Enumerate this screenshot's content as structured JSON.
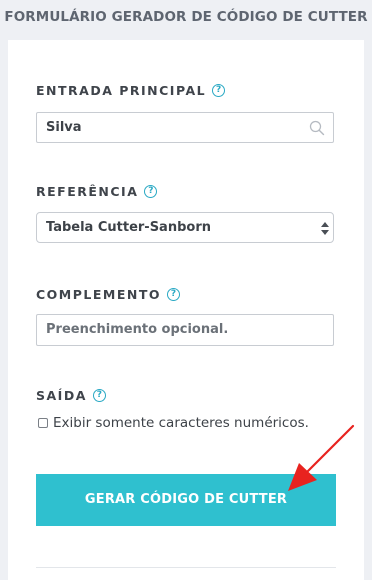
{
  "form": {
    "title": "FORMULÁRIO GERADOR DE CÓDIGO DE CUTTER"
  },
  "fields": {
    "main_entry": {
      "label": "ENTRADA PRINCIPAL",
      "value": "Silva",
      "help_icon": "?"
    },
    "reference": {
      "label": "REFERÊNCIA",
      "selected": "Tabela Cutter-Sanborn",
      "help_icon": "?"
    },
    "complement": {
      "label": "COMPLEMENTO",
      "placeholder": "Preenchimento opcional.",
      "help_icon": "?"
    },
    "output": {
      "label": "SAÍDA",
      "help_icon": "?",
      "checkbox_label": "Exibir somente caracteres numéricos."
    }
  },
  "actions": {
    "generate_label": "GERAR CÓDIGO DE CUTTER"
  },
  "colors": {
    "accent": "#2fc0cf",
    "help_icon": "#2aa9c4",
    "annotation_arrow": "#e8231f",
    "background": "#eef0f4"
  }
}
